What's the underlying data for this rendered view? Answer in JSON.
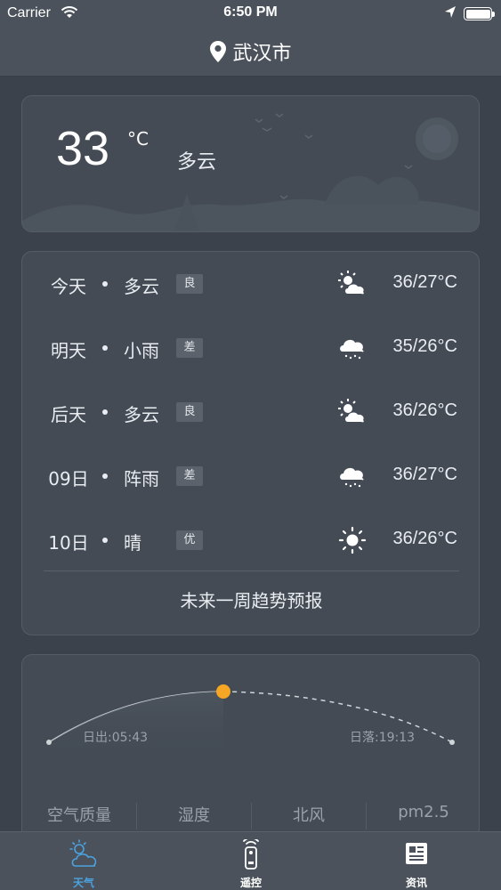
{
  "status_bar": {
    "carrier": "Carrier",
    "time": "6:50 PM"
  },
  "nav": {
    "title": "武汉市"
  },
  "now": {
    "temp": "33",
    "unit": "°C",
    "condition": "多云"
  },
  "forecast": {
    "rows": [
      {
        "day": "今天",
        "cond": "多云",
        "aqi": "良",
        "icon": "partly-cloudy-icon",
        "range": "36/27°C"
      },
      {
        "day": "明天",
        "cond": "小雨",
        "aqi": "差",
        "icon": "rain-icon",
        "range": "35/26°C"
      },
      {
        "day": "后天",
        "cond": "多云",
        "aqi": "良",
        "icon": "partly-cloudy-icon",
        "range": "36/26°C"
      },
      {
        "day": "09日",
        "cond": "阵雨",
        "aqi": "差",
        "icon": "rain-icon",
        "range": "36/27°C"
      },
      {
        "day": "10日",
        "cond": "晴",
        "aqi": "优",
        "icon": "sun-icon",
        "range": "36/26°C"
      }
    ],
    "week_link": "未来一周趋势预报"
  },
  "sun": {
    "sunrise": "日出:05:43",
    "sunset": "日落:19:13",
    "progress": 0.5,
    "metrics": [
      "空气质量",
      "湿度",
      "北风",
      "pm2.5"
    ]
  },
  "tabs": [
    {
      "label": "天气",
      "icon": "weather-icon",
      "active": true
    },
    {
      "label": "遥控",
      "icon": "remote-icon",
      "active": false
    },
    {
      "label": "资讯",
      "icon": "news-icon",
      "active": false
    }
  ],
  "colors": {
    "accent": "#4aa3e0",
    "sun_dot": "#f5a623",
    "background": "#3b424b"
  }
}
